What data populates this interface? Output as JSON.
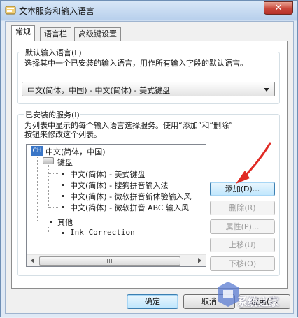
{
  "window": {
    "title": "文本服务和输入语言",
    "close_label": "✕"
  },
  "tabs": [
    {
      "label": "常规",
      "active": true
    },
    {
      "label": "语言栏",
      "active": false
    },
    {
      "label": "高级键设置",
      "active": false
    }
  ],
  "default_language": {
    "legend": "默认输入语言(L)",
    "description": "选择其中一个已安装的输入语言，用作所有输入字段的默认语言。",
    "selected": "中文(简体，中国) - 中文(简体) - 美式键盘"
  },
  "installed_services": {
    "legend": "已安装的服务(I)",
    "description_line1": "为列表中显示的每个输入语言选择服务。使用“添加”和“删除”",
    "description_line2": "按钮来修改这个列表。",
    "tree": {
      "language": {
        "badge": "CH",
        "label": "中文(简体，中国)"
      },
      "keyboard_group": "键盘",
      "keyboards": [
        "中文(简体) - 美式键盘",
        "中文(简体) - 搜狗拼音输入法",
        "中文(简体) - 微软拼音新体验输入风",
        "中文(简体) - 微软拼音 ABC 输入风"
      ],
      "other_group": "其他",
      "other_items": [
        "Ink Correction"
      ]
    },
    "buttons": {
      "add": "添加(D)...",
      "remove": "删除(R)",
      "properties": "属性(P)...",
      "move_up": "上移(U)",
      "move_down": "下移(O)"
    }
  },
  "footer": {
    "ok": "确定",
    "cancel": "取消",
    "apply": "应用(A)"
  },
  "watermark": {
    "text": "系统之家"
  },
  "colors": {
    "accent_arrow": "#e02a24",
    "title_gradient_top": "#d9e7f7",
    "close_button": "#c9473a",
    "language_badge": "#3a76c7"
  }
}
